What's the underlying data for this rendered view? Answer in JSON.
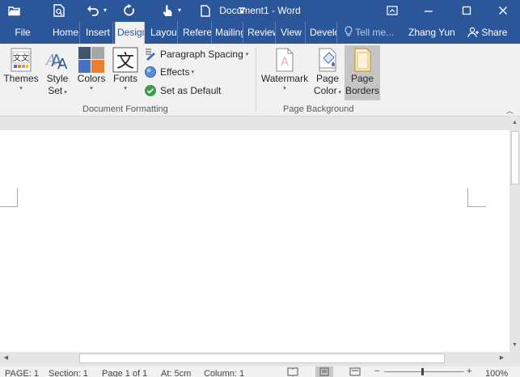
{
  "app": {
    "doc_title": "Document1 - Word",
    "colors": {
      "brand": "#2b579a",
      "ribbon_bg": "#f1f1f1",
      "page_bg": "#ffffff"
    }
  },
  "title_bar": {
    "icons": [
      "open-folder-icon",
      "print-preview-icon",
      "undo-icon",
      "redo-icon",
      "touch-mode-icon",
      "new-document-icon",
      "customize-toolbar-icon",
      "ribbon-display-options-icon",
      "minimize-icon",
      "restore-icon",
      "close-icon"
    ]
  },
  "tabs": {
    "file": "File",
    "items": [
      "Home",
      "Insert",
      "Design",
      "Layout",
      "References",
      "Mailings",
      "Review",
      "View",
      "Developer"
    ],
    "active": "Design",
    "tell_me": "Tell me...",
    "user": "Zhang Yun",
    "share": "Share"
  },
  "ribbon": {
    "document_formatting": {
      "label": "Document Formatting",
      "themes": "Themes",
      "style_set_line1": "Style",
      "style_set_line2": "Set",
      "colors": "Colors",
      "fonts": "Fonts",
      "paragraph_spacing": "Paragraph Spacing",
      "effects": "Effects",
      "set_as_default": "Set as Default"
    },
    "page_background": {
      "label": "Page Background",
      "watermark": "Watermark",
      "page_color_line1": "Page",
      "page_color_line2": "Color",
      "page_borders_line1": "Page",
      "page_borders_line2": "Borders"
    }
  },
  "status_bar": {
    "page": "PAGE: 1",
    "section": "Section: 1",
    "page_of": "Page 1 of 1",
    "at": "At: 5cm",
    "column": "Column: 1",
    "zoom": "100%"
  }
}
